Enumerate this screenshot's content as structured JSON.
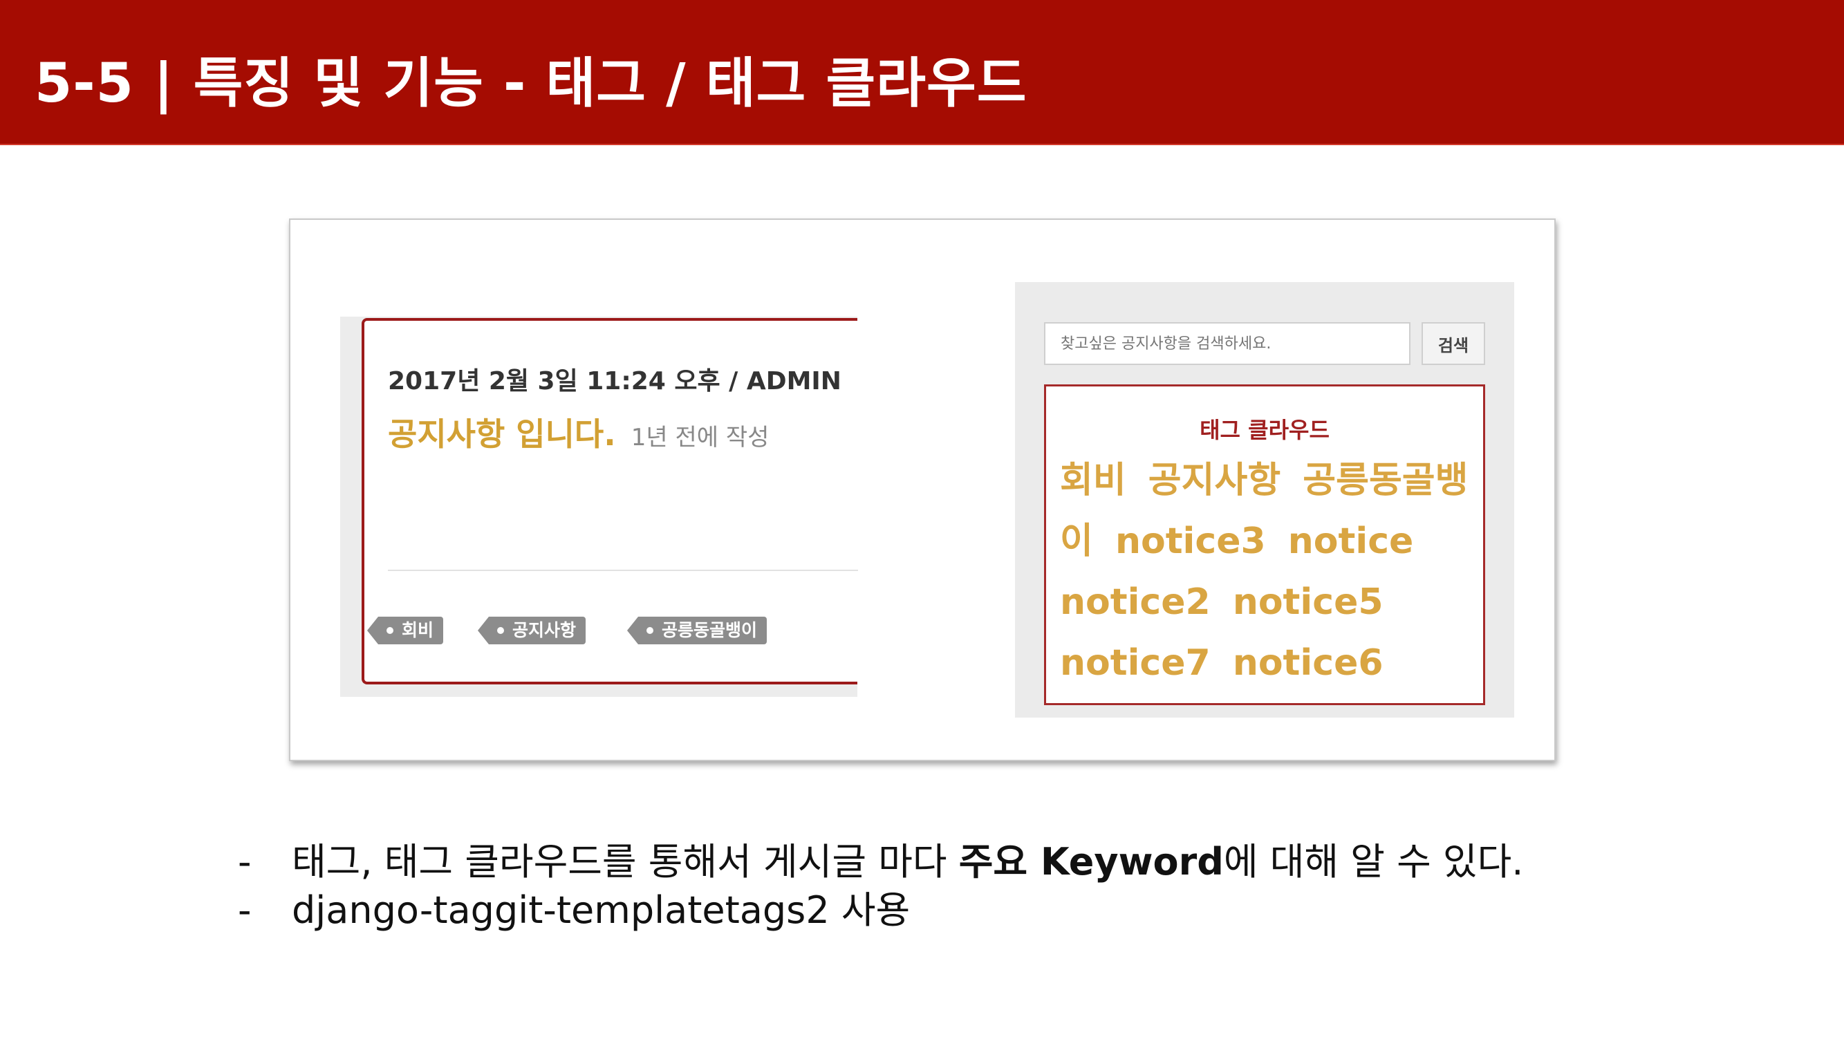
{
  "slide": {
    "title": "5-5 | 특징 및 기능 - 태그 / 태그 클라우드"
  },
  "post": {
    "date_author": "2017년 2월 3일 11:24 오후 / ADMIN",
    "title": "공지사항 입니다.",
    "ago": "1년 전에 작성",
    "tags": [
      "회비",
      "공지사항",
      "공릉동골뱅이"
    ]
  },
  "sidebar": {
    "search_placeholder": "찾고싶은 공지사항을 검색하세요.",
    "search_button": "검색",
    "cloud_title": "태그 클라우드",
    "cloud_tags": [
      "회비",
      "공지사항",
      "공릉동골뱅이",
      "notice3",
      "notice",
      "notice2",
      "notice5",
      "notice7",
      "notice6"
    ]
  },
  "bullets": [
    {
      "dash": "-",
      "before": "태그, 태그 클라우드를 통해서 게시글 마다 ",
      "bold": "주요 Keyword",
      "after": "에 대해 알 수 있다."
    },
    {
      "dash": "-",
      "text": "django-taggit-templatetags2 사용"
    }
  ],
  "colors": {
    "header_bg": "#a50c02",
    "accent_gold": "#d9a542",
    "card_border": "#9c1a1a",
    "tag_gray": "#8c8c8c"
  }
}
